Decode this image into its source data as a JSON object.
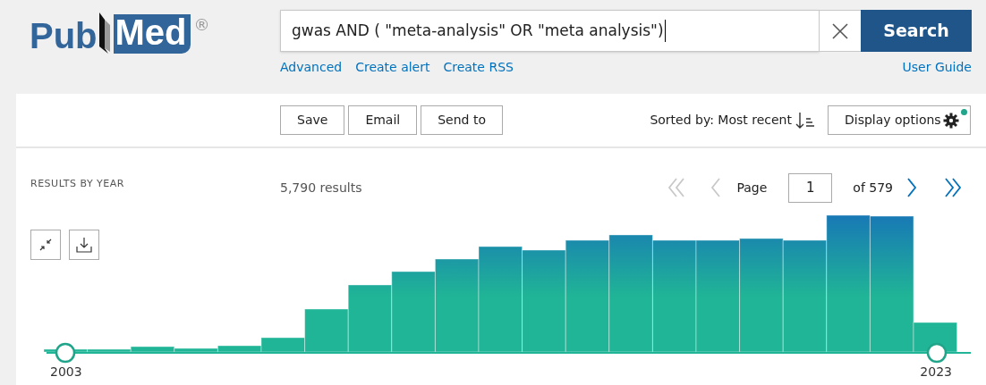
{
  "logo": {
    "text_left": "Pub",
    "text_right": "Med",
    "mark": "®"
  },
  "search": {
    "value": "gwas AND ( \"meta-analysis\" OR \"meta analysis\")",
    "button": "Search"
  },
  "search_links": [
    "Advanced",
    "Create alert",
    "Create RSS"
  ],
  "user_guide": "User Guide",
  "actions": [
    "Save",
    "Email",
    "Send to"
  ],
  "sort": {
    "label": "Sorted by: Most recent"
  },
  "display_options": {
    "label": "Display options",
    "has_update": true
  },
  "timeline": {
    "title": "RESULTS BY YEAR",
    "start": "2003",
    "end": "2023"
  },
  "results_count": "5,790 results",
  "pagination": {
    "page_label": "Page",
    "page": "1",
    "of": "of 579",
    "first_disabled": true,
    "prev_disabled": true,
    "next_disabled": false,
    "last_disabled": false
  }
}
